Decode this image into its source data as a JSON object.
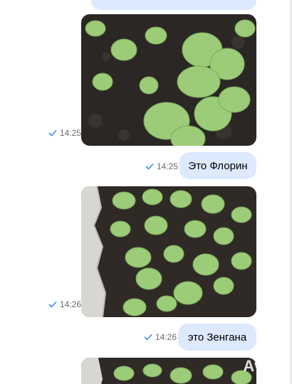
{
  "messages": [
    {
      "type": "photo",
      "time": "14:25",
      "image": "strawberry-plant-closeup-photo"
    },
    {
      "type": "text",
      "time": "14:25",
      "text": "Это Флорин"
    },
    {
      "type": "photo",
      "time": "14:26",
      "image": "strawberry-bed-photo"
    },
    {
      "type": "text",
      "time": "14:26",
      "text": "это Зенгана"
    },
    {
      "type": "photo",
      "time": "",
      "image": "strawberry-bed-photo-partial"
    }
  ],
  "watermark": "Avito",
  "colors": {
    "bubble": "#dde9ff",
    "check": "#3a8be8",
    "soil": "#2f2a26",
    "leaf": "#8fbf6a"
  }
}
